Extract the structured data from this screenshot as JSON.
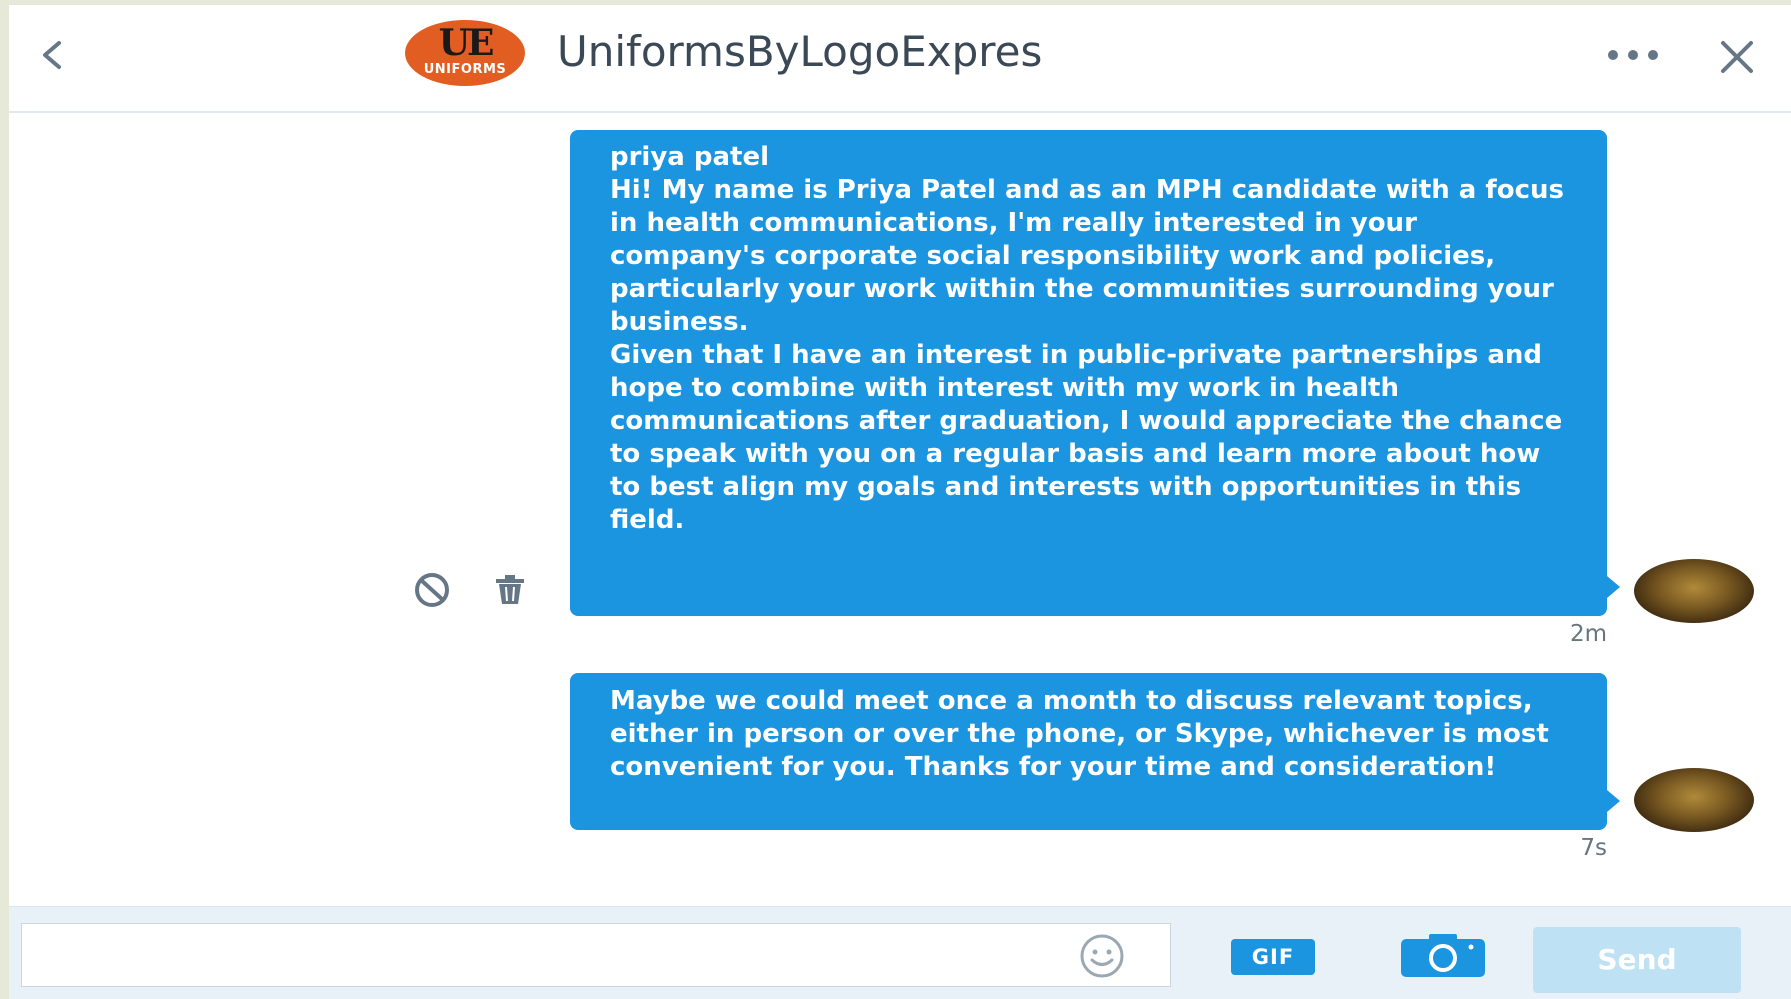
{
  "header": {
    "title": "UniformsByLogoExpres",
    "logo_monogram": "UE",
    "logo_text": "UNIFORMS",
    "back_icon": "chevron-left-icon",
    "more_icon": "more-dots-icon",
    "close_icon": "close-icon"
  },
  "messages": [
    {
      "text": "priya patel\n Hi! My name is Priya Patel and as an MPH candidate with a focus in health communications, I'm really interested in your company's corporate social responsibility work and policies, particularly your work within the communities surrounding your business.\nGiven that I have an interest in public-private partnerships and hope to combine with interest with my work in health communications after graduation, I would appreciate the chance to speak with you on a regular basis and learn more about how to best align my goals and interests with opportunities in this field.",
      "time": "2m"
    },
    {
      "text": "Maybe we could meet once a month to discuss relevant topics, either in person or over the phone, or Skype, whichever is most convenient for you. Thanks for your time and consideration!",
      "time": "7s"
    }
  ],
  "message_actions": {
    "block_icon": "block-icon",
    "delete_icon": "trash-icon"
  },
  "composer": {
    "input_value": "",
    "input_placeholder": "",
    "emoji_icon": "emoji-icon",
    "gif_label": "GIF",
    "camera_icon": "camera-icon",
    "send_label": "Send"
  },
  "colors": {
    "bubble": "#1b95e0",
    "send_disabled": "#bfe1f4",
    "logo": "#e25d21"
  }
}
